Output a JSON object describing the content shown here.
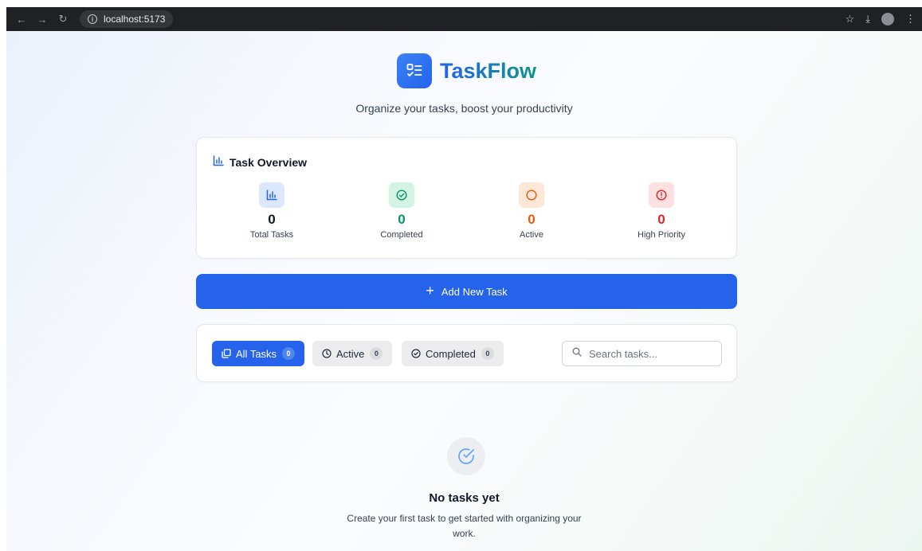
{
  "browser": {
    "url": "localhost:5173",
    "icons": [
      "back-arrow-icon",
      "forward-arrow-icon",
      "reload-icon",
      "info-icon",
      "star-icon",
      "download-icon",
      "profile-icon",
      "menu-icon"
    ]
  },
  "app": {
    "title": "TaskFlow",
    "tagline": "Organize your tasks, boost your productivity",
    "brand_color": "#2563eb",
    "accent_color": "#0d9488"
  },
  "overview": {
    "heading": "Task Overview",
    "stats": [
      {
        "label": "Total Tasks",
        "value": "0",
        "icon": "bar-chart-icon",
        "color": "#111827",
        "bg": "#dbe8fb"
      },
      {
        "label": "Completed",
        "value": "0",
        "icon": "check-circle-icon",
        "color": "#059669",
        "bg": "#d5f3e4"
      },
      {
        "label": "Active",
        "value": "0",
        "icon": "circle-icon",
        "color": "#ea580c",
        "bg": "#fde7d6"
      },
      {
        "label": "High Priority",
        "value": "0",
        "icon": "alert-circle-icon",
        "color": "#dc2626",
        "bg": "#fde0e0"
      }
    ]
  },
  "add_button": {
    "label": "Add New Task"
  },
  "filters": {
    "tabs": [
      {
        "label": "All Tasks",
        "count": "0",
        "active": true
      },
      {
        "label": "Active",
        "count": "0",
        "active": false
      },
      {
        "label": "Completed",
        "count": "0",
        "active": false
      }
    ],
    "search_placeholder": "Search tasks..."
  },
  "empty_state": {
    "title": "No tasks yet",
    "text": "Create your first task to get started with organizing your work."
  }
}
